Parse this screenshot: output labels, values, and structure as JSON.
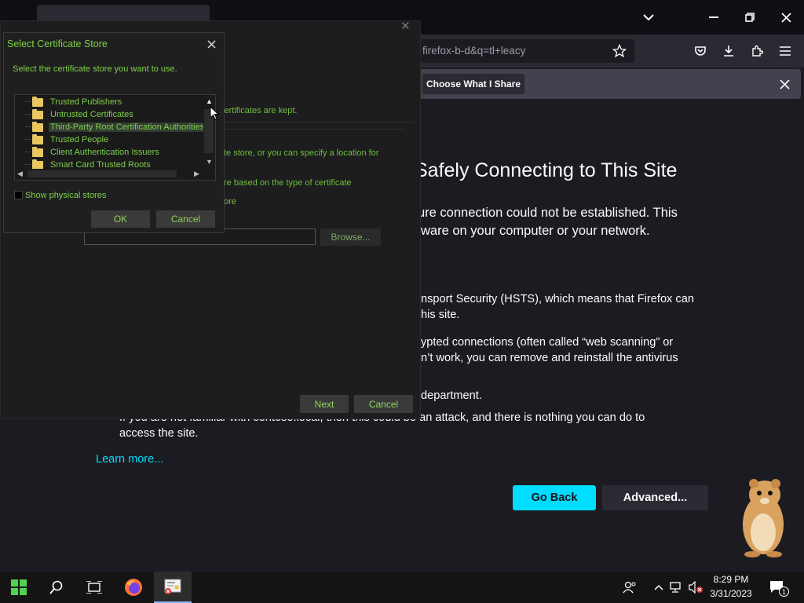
{
  "browser": {
    "url": "firefox-b-d&q=tl+leacy",
    "notification_button": "Choose What I Share",
    "error": {
      "title": "Safely Connecting to This Site",
      "para1_line1": "ure connection could not be established. This",
      "para1_line2": "ware on your computer or your network.",
      "para2_line1": "nsport Security (HSTS), which means that Firefox can",
      "para2_line2": "his site.",
      "para3_line1": "ypted connections (often called “web scanning” or",
      "para3_line2": "n’t work, you can remove and reinstall the antivirus",
      "para4_line1": "department.",
      "para5_line1": "If you are not familiar with contoso.local, then this could be an attack, and there is nothing you can do to",
      "para5_line2": "access the site.",
      "learn_more": "Learn more...",
      "go_back": "Go Back",
      "advanced": "Advanced..."
    }
  },
  "wizard": {
    "line1": "certificates are kept.",
    "line2": "te store, or you can specify a location for",
    "line3": "re based on the type of certificate",
    "line4": "ore",
    "browse": "Browse...",
    "next": "Next",
    "cancel": "Cancel"
  },
  "cert_store_dialog": {
    "title": "Select Certificate Store",
    "instruction": "Select the certificate store you want to use.",
    "stores": [
      "Trusted Publishers",
      "Untrusted Certificates",
      "Third-Party Root Certification Authorities",
      "Trusted People",
      "Client Authentication Issuers",
      "Smart Card Trusted Roots"
    ],
    "selected_index": 2,
    "show_physical": "Show physical stores",
    "ok": "OK",
    "cancel": "Cancel"
  },
  "taskbar": {
    "time": "8:29 PM",
    "date": "3/31/2023",
    "notification_count": "1"
  },
  "colors": {
    "accent_cyan": "#00ddff",
    "dialog_text_green": "#7fd04a",
    "selection_highlight": "#333d33"
  }
}
